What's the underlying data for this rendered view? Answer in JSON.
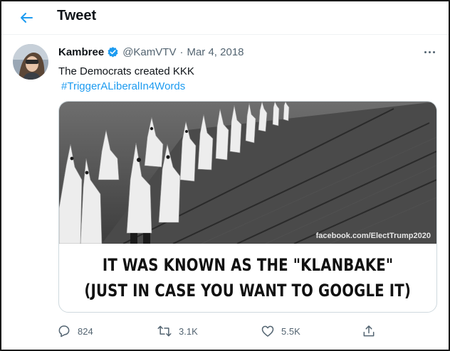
{
  "header": {
    "title": "Tweet",
    "back_icon": "arrow-left-icon"
  },
  "tweet": {
    "author_name": "Kambree",
    "verified_icon": "verified-badge-icon",
    "handle": "@KamVTV",
    "separator": "·",
    "date": "Mar 4, 2018",
    "text": "The Democrats created KKK",
    "hashtag": "#TriggerALiberalIn4Words",
    "more_icon": "more-horizontal-icon"
  },
  "media": {
    "watermark": "facebook.com/ElectTrump2020",
    "caption_line1": "IT WAS KNOWN AS THE \"KLANBAKE\"",
    "caption_line2": "(JUST IN CASE YOU WANT TO GOOGLE IT)"
  },
  "actions": {
    "reply_count": "824",
    "retweet_count": "3.1K",
    "like_count": "5.5K",
    "icons": [
      "reply-icon",
      "retweet-icon",
      "like-icon",
      "share-icon"
    ]
  },
  "colors": {
    "accent": "#1d9bf0",
    "text_primary": "#0f1419",
    "text_secondary": "#536471",
    "border": "#cfd9de"
  }
}
